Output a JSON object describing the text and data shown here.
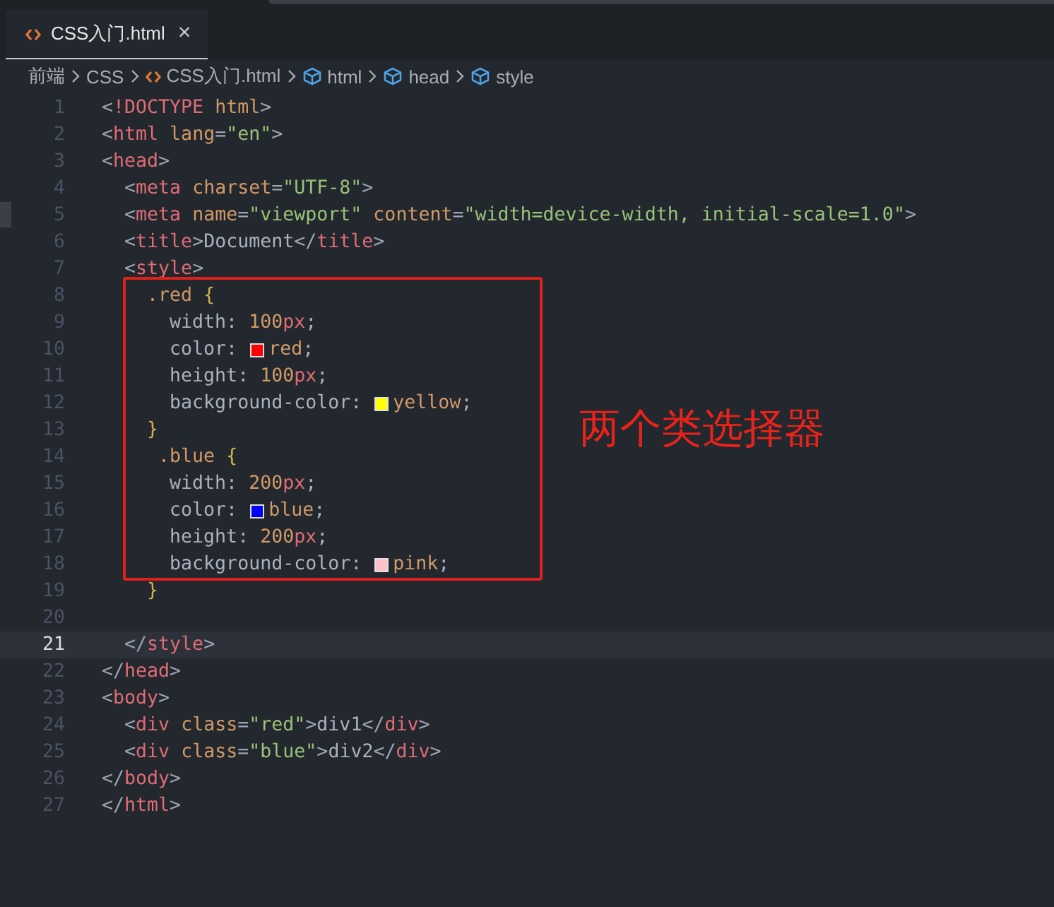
{
  "tabs": [
    {
      "label": "CSS入门.html",
      "selected": true,
      "close": "×"
    }
  ],
  "breadcrumbs": [
    {
      "label": "前端",
      "kind": "folder"
    },
    {
      "label": "CSS",
      "kind": "folder"
    },
    {
      "label": "CSS入门.html",
      "kind": "file"
    },
    {
      "label": "html",
      "kind": "element"
    },
    {
      "label": "head",
      "kind": "element"
    },
    {
      "label": "style",
      "kind": "element"
    }
  ],
  "code_lines": [
    {
      "n": "1",
      "current": false,
      "tokens": [
        {
          "kind": "p",
          "t": "<"
        },
        {
          "kind": "tag",
          "t": "!DOCTYPE"
        },
        {
          "kind": "attr",
          "t": " html"
        },
        {
          "kind": "p",
          "t": ">"
        }
      ]
    },
    {
      "n": "2",
      "current": false,
      "tokens": [
        {
          "kind": "p",
          "t": "<"
        },
        {
          "kind": "tag",
          "t": "html"
        },
        {
          "kind": "attr",
          "t": " lang"
        },
        {
          "kind": "p",
          "t": "="
        },
        {
          "kind": "str",
          "t": "\"en\""
        },
        {
          "kind": "p",
          "t": ">"
        }
      ]
    },
    {
      "n": "3",
      "current": false,
      "tokens": [
        {
          "kind": "p",
          "t": "<"
        },
        {
          "kind": "tag",
          "t": "head"
        },
        {
          "kind": "p",
          "t": ">"
        }
      ]
    },
    {
      "n": "4",
      "current": false,
      "tokens": [
        {
          "kind": "p",
          "t": "  <"
        },
        {
          "kind": "tag",
          "t": "meta"
        },
        {
          "kind": "attr",
          "t": " charset"
        },
        {
          "kind": "p",
          "t": "="
        },
        {
          "kind": "str",
          "t": "\"UTF-8\""
        },
        {
          "kind": "p",
          "t": ">"
        }
      ]
    },
    {
      "n": "5",
      "current": false,
      "tokens": [
        {
          "kind": "p",
          "t": "  <"
        },
        {
          "kind": "tag",
          "t": "meta"
        },
        {
          "kind": "attr",
          "t": " name"
        },
        {
          "kind": "p",
          "t": "="
        },
        {
          "kind": "str",
          "t": "\"viewport\""
        },
        {
          "kind": "attr",
          "t": " content"
        },
        {
          "kind": "p",
          "t": "="
        },
        {
          "kind": "str",
          "t": "\"width=device-width, initial-scale=1.0\""
        },
        {
          "kind": "p",
          "t": ">"
        }
      ]
    },
    {
      "n": "6",
      "current": false,
      "tokens": [
        {
          "kind": "p",
          "t": "  <"
        },
        {
          "kind": "tag",
          "t": "title"
        },
        {
          "kind": "p",
          "t": ">"
        },
        {
          "kind": "text",
          "t": "Document"
        },
        {
          "kind": "p",
          "t": "</"
        },
        {
          "kind": "tag",
          "t": "title"
        },
        {
          "kind": "p",
          "t": ">"
        }
      ]
    },
    {
      "n": "7",
      "current": false,
      "tokens": [
        {
          "kind": "p",
          "t": "  <"
        },
        {
          "kind": "tag",
          "t": "style"
        },
        {
          "kind": "p",
          "t": ">"
        }
      ]
    },
    {
      "n": "8",
      "current": false,
      "tokens": [
        {
          "kind": "sel",
          "t": "    .red"
        },
        {
          "kind": "brace",
          "t": " {"
        }
      ]
    },
    {
      "n": "9",
      "current": false,
      "tokens": [
        {
          "kind": "text",
          "t": "      width: "
        },
        {
          "kind": "num",
          "t": "100"
        },
        {
          "kind": "unit",
          "t": "px"
        },
        {
          "kind": "text",
          "t": ";"
        }
      ]
    },
    {
      "n": "10",
      "current": false,
      "tokens": [
        {
          "kind": "text",
          "t": "      color: "
        },
        {
          "kind": "swatch",
          "color": "#ff0000"
        },
        {
          "kind": "num",
          "t": "red"
        },
        {
          "kind": "text",
          "t": ";"
        }
      ]
    },
    {
      "n": "11",
      "current": false,
      "tokens": [
        {
          "kind": "text",
          "t": "      height: "
        },
        {
          "kind": "num",
          "t": "100"
        },
        {
          "kind": "unit",
          "t": "px"
        },
        {
          "kind": "text",
          "t": ";"
        }
      ]
    },
    {
      "n": "12",
      "current": false,
      "tokens": [
        {
          "kind": "text",
          "t": "      background-color: "
        },
        {
          "kind": "swatch",
          "color": "#ffff00"
        },
        {
          "kind": "num",
          "t": "yellow"
        },
        {
          "kind": "text",
          "t": ";"
        }
      ]
    },
    {
      "n": "13",
      "current": false,
      "tokens": [
        {
          "kind": "brace",
          "t": "    }"
        }
      ]
    },
    {
      "n": "14",
      "current": false,
      "tokens": [
        {
          "kind": "sel",
          "t": "     .blue"
        },
        {
          "kind": "brace",
          "t": " {"
        }
      ]
    },
    {
      "n": "15",
      "current": false,
      "tokens": [
        {
          "kind": "text",
          "t": "      width: "
        },
        {
          "kind": "num",
          "t": "200"
        },
        {
          "kind": "unit",
          "t": "px"
        },
        {
          "kind": "text",
          "t": ";"
        }
      ]
    },
    {
      "n": "16",
      "current": false,
      "tokens": [
        {
          "kind": "text",
          "t": "      color: "
        },
        {
          "kind": "swatch",
          "color": "#0000ff"
        },
        {
          "kind": "num",
          "t": "blue"
        },
        {
          "kind": "text",
          "t": ";"
        }
      ]
    },
    {
      "n": "17",
      "current": false,
      "tokens": [
        {
          "kind": "text",
          "t": "      height: "
        },
        {
          "kind": "num",
          "t": "200"
        },
        {
          "kind": "unit",
          "t": "px"
        },
        {
          "kind": "text",
          "t": ";"
        }
      ]
    },
    {
      "n": "18",
      "current": false,
      "tokens": [
        {
          "kind": "text",
          "t": "      background-color: "
        },
        {
          "kind": "swatch",
          "color": "#ffc0cb"
        },
        {
          "kind": "num",
          "t": "pink"
        },
        {
          "kind": "text",
          "t": ";"
        }
      ]
    },
    {
      "n": "19",
      "current": false,
      "tokens": [
        {
          "kind": "brace",
          "t": "    }"
        }
      ]
    },
    {
      "n": "20",
      "current": false
    },
    {
      "n": "21",
      "current": true,
      "tokens": [
        {
          "kind": "p",
          "t": "  </"
        },
        {
          "kind": "tag",
          "t": "style"
        },
        {
          "kind": "p",
          "t": ">"
        }
      ]
    },
    {
      "n": "22",
      "current": false,
      "tokens": [
        {
          "kind": "p",
          "t": "</"
        },
        {
          "kind": "tag",
          "t": "head"
        },
        {
          "kind": "p",
          "t": ">"
        }
      ]
    },
    {
      "n": "23",
      "current": false,
      "tokens": [
        {
          "kind": "p",
          "t": "<"
        },
        {
          "kind": "tag",
          "t": "body"
        },
        {
          "kind": "p",
          "t": ">"
        }
      ]
    },
    {
      "n": "24",
      "current": false,
      "tokens": [
        {
          "kind": "p",
          "t": "  <"
        },
        {
          "kind": "tag",
          "t": "div"
        },
        {
          "kind": "attr",
          "t": " class"
        },
        {
          "kind": "p",
          "t": "="
        },
        {
          "kind": "str",
          "t": "\"red\""
        },
        {
          "kind": "p",
          "t": ">"
        },
        {
          "kind": "text",
          "t": "div1"
        },
        {
          "kind": "p",
          "t": "</"
        },
        {
          "kind": "tag",
          "t": "div"
        },
        {
          "kind": "p",
          "t": ">"
        }
      ]
    },
    {
      "n": "25",
      "current": false,
      "tokens": [
        {
          "kind": "p",
          "t": "  <"
        },
        {
          "kind": "tag",
          "t": "div"
        },
        {
          "kind": "attr",
          "t": " class"
        },
        {
          "kind": "p",
          "t": "="
        },
        {
          "kind": "str",
          "t": "\"blue\""
        },
        {
          "kind": "p",
          "t": ">"
        },
        {
          "kind": "text",
          "t": "div2"
        },
        {
          "kind": "p",
          "t": "</"
        },
        {
          "kind": "tag",
          "t": "div"
        },
        {
          "kind": "p",
          "t": ">"
        }
      ]
    },
    {
      "n": "26",
      "current": false,
      "tokens": [
        {
          "kind": "p",
          "t": "</"
        },
        {
          "kind": "tag",
          "t": "body"
        },
        {
          "kind": "p",
          "t": ">"
        }
      ]
    },
    {
      "n": "27",
      "current": false,
      "tokens": [
        {
          "kind": "p",
          "t": "</"
        },
        {
          "kind": "tag",
          "t": "html"
        },
        {
          "kind": "p",
          "t": ">"
        }
      ]
    }
  ],
  "annotation": {
    "label": "两个类选择器"
  }
}
